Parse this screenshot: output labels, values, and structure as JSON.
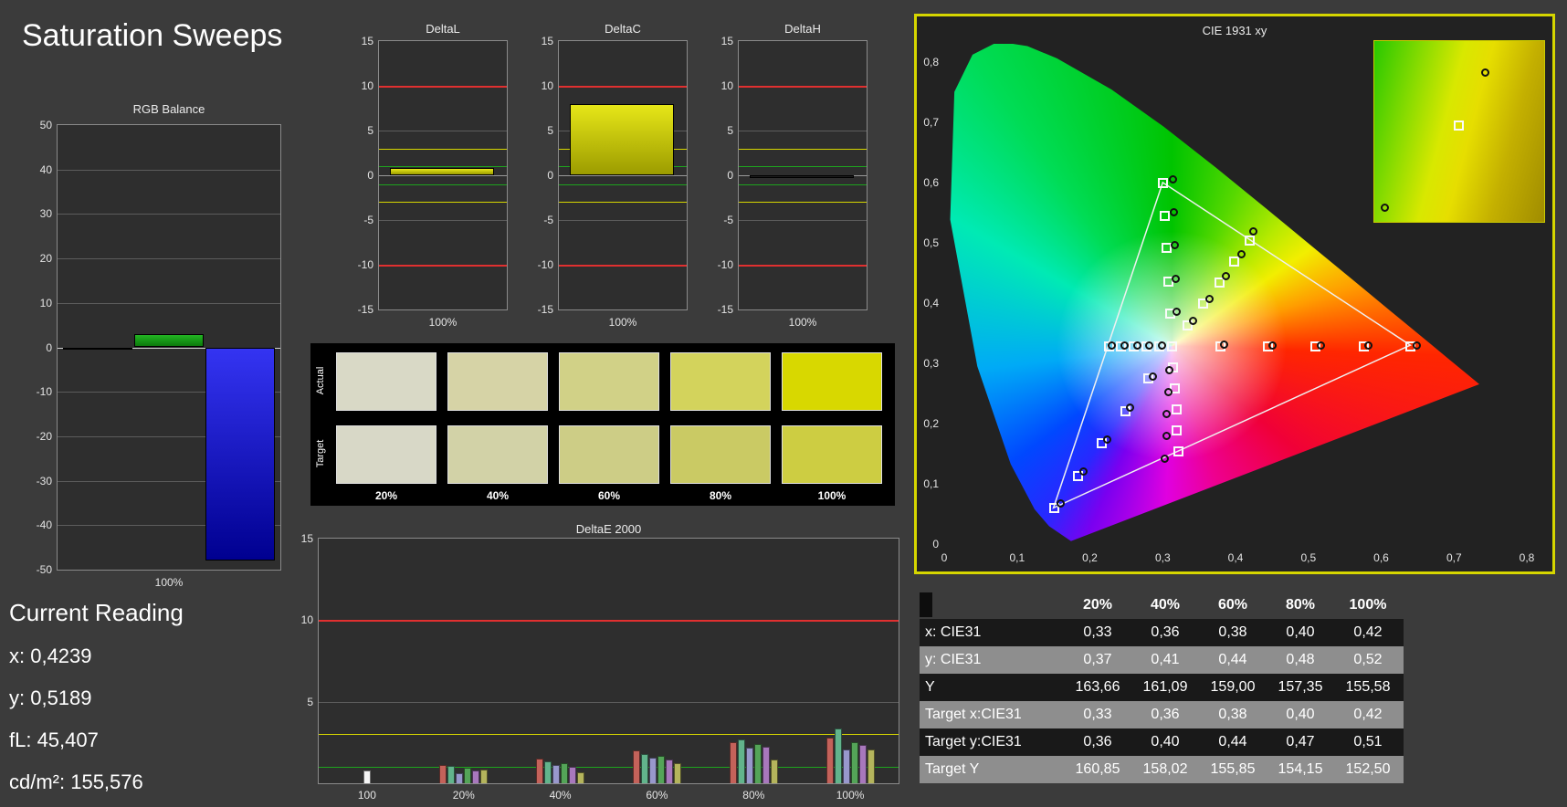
{
  "page": {
    "title": "Saturation Sweeps"
  },
  "current_reading": {
    "heading": "Current Reading",
    "lines": [
      "x: 0,4239",
      "y: 0,5189",
      "fL: 45,407",
      "cd/m²: 155,576"
    ]
  },
  "swatches": {
    "row_labels": [
      "Actual",
      "Target"
    ],
    "col_labels": [
      "20%",
      "40%",
      "60%",
      "80%",
      "100%"
    ],
    "actual_colors": [
      "#d9d9c6",
      "#d6d3a6",
      "#d1d187",
      "#d3d35c",
      "#d8d800"
    ],
    "target_colors": [
      "#d8d8c7",
      "#d2d2a7",
      "#cdcd86",
      "#caca64",
      "#cdcd42"
    ]
  },
  "table": {
    "col_headers": [
      "",
      "20%",
      "40%",
      "60%",
      "80%",
      "100%"
    ],
    "rows": [
      {
        "label": "x: CIE31",
        "values": [
          "0,33",
          "0,36",
          "0,38",
          "0,40",
          "0,42"
        ],
        "shaded": false
      },
      {
        "label": "y: CIE31",
        "values": [
          "0,37",
          "0,41",
          "0,44",
          "0,48",
          "0,52"
        ],
        "shaded": true
      },
      {
        "label": "Y",
        "values": [
          "163,66",
          "161,09",
          "159,00",
          "157,35",
          "155,58"
        ],
        "shaded": false
      },
      {
        "label": "Target x:CIE31",
        "values": [
          "0,33",
          "0,36",
          "0,38",
          "0,40",
          "0,42"
        ],
        "shaded": true
      },
      {
        "label": "Target y:CIE31",
        "values": [
          "0,36",
          "0,40",
          "0,44",
          "0,47",
          "0,51"
        ],
        "shaded": false
      },
      {
        "label": "Target Y",
        "values": [
          "160,85",
          "158,02",
          "155,85",
          "154,15",
          "152,50"
        ],
        "shaded": true
      }
    ]
  },
  "chart_data": [
    {
      "id": "rgb_balance",
      "type": "bar",
      "title": "RGB Balance",
      "categories": [
        "100%"
      ],
      "ylim": [
        -50,
        50
      ],
      "ytick_step": 10,
      "series": [
        {
          "name": "Red",
          "color": "#6a1212",
          "values": [
            -0.5
          ]
        },
        {
          "name": "Green",
          "color": "#23b523",
          "color_dark": "#0c7a0c",
          "values": [
            3
          ]
        },
        {
          "name": "Blue",
          "color": "#3434f2",
          "color_dark": "#000090",
          "values": [
            -48
          ]
        }
      ]
    },
    {
      "id": "delta_l",
      "type": "bar",
      "title": "DeltaL",
      "categories": [
        "100%"
      ],
      "ylim": [
        -15,
        15
      ],
      "ref_lines": [
        {
          "v": 10,
          "color": "#e03030"
        },
        {
          "v": 3,
          "color": "#d6d600"
        },
        {
          "v": 1,
          "color": "#1ea41e"
        },
        {
          "v": -1,
          "color": "#1ea41e"
        },
        {
          "v": -3,
          "color": "#d6d600"
        },
        {
          "v": -10,
          "color": "#e03030"
        }
      ],
      "series": [
        {
          "name": "DeltaL",
          "color": "#e6e618",
          "color_dark": "#9c9c00",
          "values": [
            0.8
          ]
        }
      ]
    },
    {
      "id": "delta_c",
      "type": "bar",
      "title": "DeltaC",
      "categories": [
        "100%"
      ],
      "ylim": [
        -15,
        15
      ],
      "ref_lines": [
        {
          "v": 10,
          "color": "#e03030"
        },
        {
          "v": 3,
          "color": "#d6d600"
        },
        {
          "v": 1,
          "color": "#1ea41e"
        },
        {
          "v": -1,
          "color": "#1ea41e"
        },
        {
          "v": -3,
          "color": "#d6d600"
        },
        {
          "v": -10,
          "color": "#e03030"
        }
      ],
      "series": [
        {
          "name": "DeltaC",
          "color": "#e6e618",
          "color_dark": "#9c9c00",
          "values": [
            8
          ]
        }
      ]
    },
    {
      "id": "delta_h",
      "type": "bar",
      "title": "DeltaH",
      "categories": [
        "100%"
      ],
      "ylim": [
        -15,
        15
      ],
      "ref_lines": [
        {
          "v": 10,
          "color": "#e03030"
        },
        {
          "v": 3,
          "color": "#d6d600"
        },
        {
          "v": 1,
          "color": "#1ea41e"
        },
        {
          "v": -1,
          "color": "#1ea41e"
        },
        {
          "v": -3,
          "color": "#d6d600"
        },
        {
          "v": -10,
          "color": "#e03030"
        }
      ],
      "series": [
        {
          "name": "DeltaH",
          "color": "#1c1c1c",
          "values": [
            -0.3
          ]
        }
      ]
    },
    {
      "id": "delta_e2000",
      "type": "bar",
      "title": "DeltaE 2000",
      "categories": [
        "100",
        "20%",
        "40%",
        "60%",
        "80%",
        "100%"
      ],
      "ylim": [
        0,
        15
      ],
      "ref_lines": [
        {
          "v": 10,
          "color": "#e03030"
        },
        {
          "v": 3,
          "color": "#d6d600"
        },
        {
          "v": 1,
          "color": "#1ea41e"
        }
      ],
      "groups": [
        {
          "label": "100",
          "values": [
            0.8
          ],
          "colors": [
            "#f5f5f5"
          ]
        },
        {
          "label": "20%",
          "values": [
            1.15,
            1.05,
            0.6,
            0.95,
            0.8,
            0.85
          ],
          "colors": [
            "#c4625a",
            "#62b48c",
            "#9898cc",
            "#54a458",
            "#a878bc",
            "#b4b45c"
          ]
        },
        {
          "label": "40%",
          "values": [
            1.5,
            1.35,
            1.1,
            1.25,
            1.0,
            0.7
          ],
          "colors": [
            "#c4625a",
            "#62b48c",
            "#9898cc",
            "#54a458",
            "#a878bc",
            "#b4b45c"
          ]
        },
        {
          "label": "60%",
          "values": [
            2.0,
            1.8,
            1.55,
            1.7,
            1.45,
            1.25
          ],
          "colors": [
            "#c4625a",
            "#62b48c",
            "#9898cc",
            "#54a458",
            "#a878bc",
            "#b4b45c"
          ]
        },
        {
          "label": "80%",
          "values": [
            2.5,
            2.7,
            2.2,
            2.4,
            2.25,
            1.45
          ],
          "colors": [
            "#c4625a",
            "#62b48c",
            "#9898cc",
            "#54a458",
            "#a878bc",
            "#b4b45c"
          ]
        },
        {
          "label": "100%",
          "values": [
            2.8,
            3.35,
            2.1,
            2.5,
            2.35,
            2.05
          ],
          "colors": [
            "#c4625a",
            "#62b48c",
            "#9898cc",
            "#54a458",
            "#a878bc",
            "#b4b45c"
          ]
        }
      ]
    },
    {
      "id": "cie_1931",
      "type": "scatter",
      "title": "CIE 1931 xy",
      "xlim": [
        0,
        0.82
      ],
      "ylim": [
        0,
        0.83
      ],
      "tick_labels": [
        "0",
        "0,1",
        "0,2",
        "0,3",
        "0,4",
        "0,5",
        "0,6",
        "0,7",
        "0,8"
      ],
      "white_point": [
        0.3127,
        0.329
      ],
      "srgb_triangle": [
        [
          0.64,
          0.33
        ],
        [
          0.3,
          0.6
        ],
        [
          0.15,
          0.06
        ]
      ],
      "locus": [
        [
          0.1741,
          0.005
        ],
        [
          0.144,
          0.0297
        ],
        [
          0.1241,
          0.0578
        ],
        [
          0.0913,
          0.1327
        ],
        [
          0.0454,
          0.295
        ],
        [
          0.0082,
          0.5384
        ],
        [
          0.0139,
          0.7502
        ],
        [
          0.0389,
          0.812
        ],
        [
          0.0743,
          0.8338
        ],
        [
          0.1142,
          0.8262
        ],
        [
          0.1547,
          0.8059
        ],
        [
          0.2296,
          0.7543
        ],
        [
          0.3016,
          0.6923
        ],
        [
          0.3731,
          0.6245
        ],
        [
          0.4441,
          0.5547
        ],
        [
          0.5125,
          0.4866
        ],
        [
          0.5752,
          0.4242
        ],
        [
          0.627,
          0.3725
        ],
        [
          0.6658,
          0.334
        ],
        [
          0.6915,
          0.3083
        ],
        [
          0.7079,
          0.292
        ],
        [
          0.719,
          0.2809
        ],
        [
          0.7347,
          0.2653
        ]
      ],
      "targets": [
        [
          0.378,
          0.329
        ],
        [
          0.444,
          0.329
        ],
        [
          0.509,
          0.329
        ],
        [
          0.575,
          0.329
        ],
        [
          0.64,
          0.329
        ],
        [
          0.31,
          0.383
        ],
        [
          0.307,
          0.437
        ],
        [
          0.305,
          0.492
        ],
        [
          0.302,
          0.546
        ],
        [
          0.3,
          0.6
        ],
        [
          0.28,
          0.275
        ],
        [
          0.248,
          0.221
        ],
        [
          0.215,
          0.168
        ],
        [
          0.183,
          0.114
        ],
        [
          0.15,
          0.06
        ],
        [
          0.295,
          0.329
        ],
        [
          0.277,
          0.329
        ],
        [
          0.26,
          0.329
        ],
        [
          0.242,
          0.329
        ],
        [
          0.225,
          0.329
        ],
        [
          0.314,
          0.294
        ],
        [
          0.316,
          0.259
        ],
        [
          0.318,
          0.224
        ],
        [
          0.319,
          0.189
        ],
        [
          0.321,
          0.154
        ],
        [
          0.334,
          0.364
        ],
        [
          0.355,
          0.4
        ],
        [
          0.377,
          0.435
        ],
        [
          0.398,
          0.47
        ],
        [
          0.419,
          0.505
        ],
        [
          0.3127,
          0.329
        ]
      ],
      "measured": [
        [
          0.384,
          0.332
        ],
        [
          0.45,
          0.331
        ],
        [
          0.516,
          0.331
        ],
        [
          0.582,
          0.33
        ],
        [
          0.648,
          0.33
        ],
        [
          0.318,
          0.386
        ],
        [
          0.317,
          0.441
        ],
        [
          0.316,
          0.497
        ],
        [
          0.315,
          0.552
        ],
        [
          0.314,
          0.606
        ],
        [
          0.286,
          0.279
        ],
        [
          0.255,
          0.227
        ],
        [
          0.223,
          0.175
        ],
        [
          0.191,
          0.122
        ],
        [
          0.159,
          0.068
        ],
        [
          0.298,
          0.33
        ],
        [
          0.281,
          0.33
        ],
        [
          0.264,
          0.33
        ],
        [
          0.247,
          0.33
        ],
        [
          0.23,
          0.33
        ],
        [
          0.309,
          0.29
        ],
        [
          0.307,
          0.253
        ],
        [
          0.305,
          0.216
        ],
        [
          0.304,
          0.18
        ],
        [
          0.302,
          0.143
        ],
        [
          0.341,
          0.371
        ],
        [
          0.363,
          0.408
        ],
        [
          0.386,
          0.445
        ],
        [
          0.408,
          0.482
        ],
        [
          0.424,
          0.519
        ]
      ],
      "inset_markers": [
        {
          "type": "circle",
          "x": 63,
          "y": 15
        },
        {
          "type": "square",
          "x": 47,
          "y": 44
        },
        {
          "type": "circle",
          "x": 4,
          "y": 90
        }
      ]
    }
  ]
}
